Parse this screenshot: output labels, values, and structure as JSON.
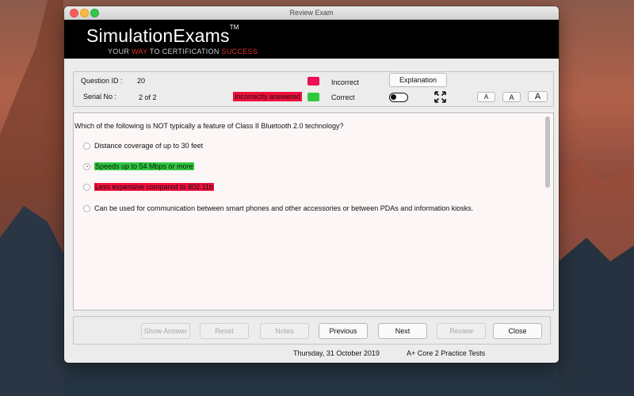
{
  "window": {
    "title": "Review Exam"
  },
  "banner": {
    "brand": "SimulationExams",
    "trademark": "TM",
    "tagline_parts": [
      "YOUR ",
      "WAY",
      " TO CERTIFICATION ",
      "SUCCESS"
    ]
  },
  "info": {
    "question_id_label": "Question ID :",
    "question_id_value": "20",
    "serial_label": "Serial No :",
    "serial_value": "2 of 2",
    "status": "Incorrectly answered",
    "legend_incorrect": "Incorrect",
    "legend_correct": "Correct",
    "explanation_button": "Explanation",
    "font_buttons": [
      "A",
      "A",
      "A"
    ]
  },
  "question": {
    "text": "Which of the following is NOT typically a feature of Class II Bluetooth 2.0 technology?",
    "options": [
      {
        "text": "Distance coverage of up to 30 feet",
        "highlight": "none",
        "selected": false
      },
      {
        "text": "Speeds up to 54 Mbps or more",
        "highlight": "correct",
        "selected": true
      },
      {
        "text": "Less expensive compared to 802.11b",
        "highlight": "incorrect",
        "selected": false
      },
      {
        "text": "Can be used for communication between smart phones and other accessories or between PDAs and information kiosks.",
        "highlight": "none",
        "selected": false
      }
    ]
  },
  "nav": {
    "show_answer": "Show Answer",
    "reset": "Reset",
    "notes": "Notes",
    "previous": "Previous",
    "next": "Next",
    "review": "Review",
    "close": "Close"
  },
  "footer": {
    "date": "Thursday, 31 October 2019",
    "app": "A+ Core 2 Practice Tests"
  },
  "colors": {
    "incorrect": "#f00f3c",
    "correct": "#2ec83f",
    "incorrect_swatch": "#ef0f55",
    "tag_red": "#e0302f"
  }
}
